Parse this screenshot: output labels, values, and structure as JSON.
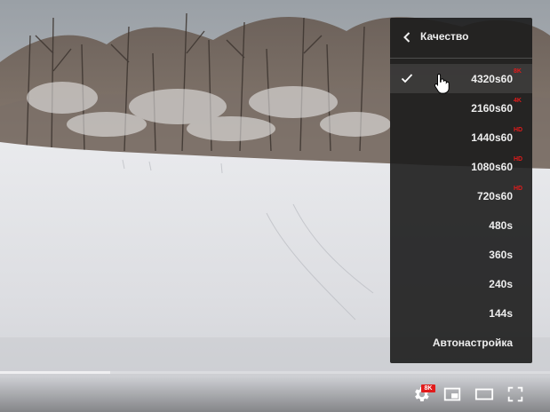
{
  "player": {
    "progress": {
      "loaded_fraction": 0.2
    },
    "controls": {
      "settings_badge": "8K",
      "icons": [
        "settings-gear-icon",
        "miniplayer-icon",
        "theater-mode-icon",
        "fullscreen-icon"
      ]
    }
  },
  "quality_menu": {
    "title": "Качество",
    "selected_index": 0,
    "items": [
      {
        "label": "4320s60",
        "badge": "8K"
      },
      {
        "label": "2160s60",
        "badge": "4K"
      },
      {
        "label": "1440s60",
        "badge": "HD"
      },
      {
        "label": "1080s60",
        "badge": "HD"
      },
      {
        "label": "720s60",
        "badge": "HD"
      },
      {
        "label": "480s",
        "badge": ""
      },
      {
        "label": "360s",
        "badge": ""
      },
      {
        "label": "240s",
        "badge": ""
      },
      {
        "label": "144s",
        "badge": ""
      },
      {
        "label": "Автонастройка",
        "badge": ""
      }
    ]
  },
  "colors": {
    "badge_red": "#e21b1b",
    "menu_bg": "#1c1c1c",
    "menu_text": "#eeeeee"
  }
}
